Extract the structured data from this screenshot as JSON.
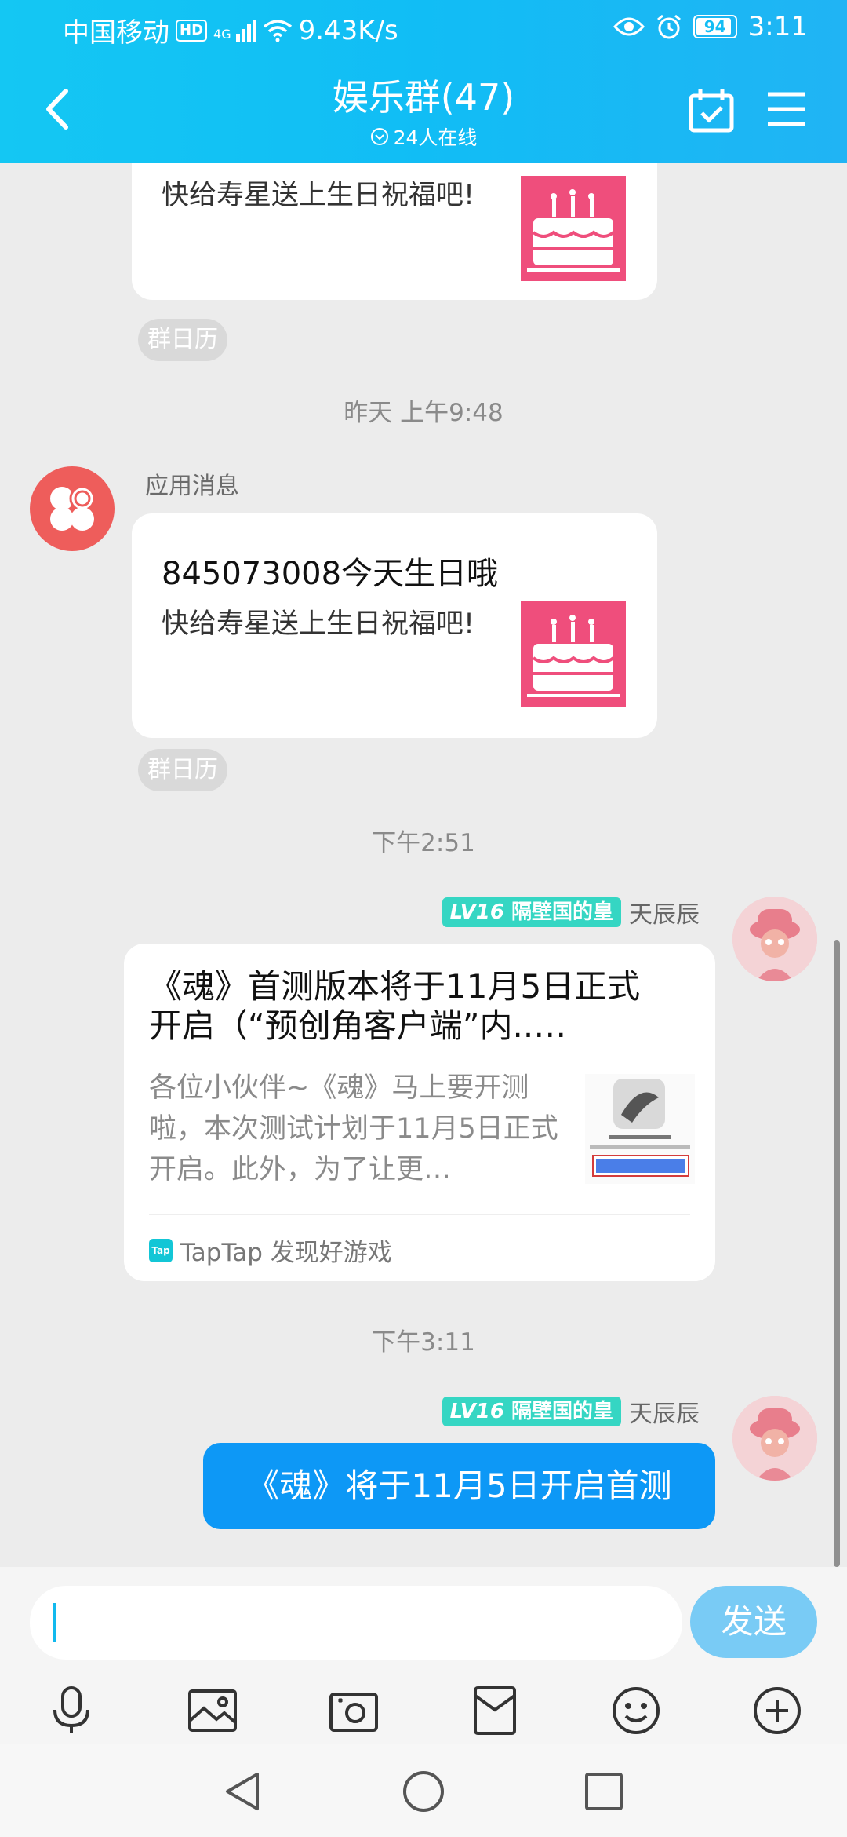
{
  "status_bar": {
    "carrier": "中国移动",
    "hd": "HD",
    "network": "4G",
    "speed": "9.43K/s",
    "battery": "94",
    "time": "3:11"
  },
  "header": {
    "title": "娱乐群(47)",
    "online": "24人在线"
  },
  "messages": {
    "card1": {
      "subtitle": "快给寿星送上生日祝福吧!",
      "tag": "群日历"
    },
    "time1": "昨天 上午9:48",
    "app_sender": "应用消息",
    "card2": {
      "title": "845073008今天生日哦",
      "subtitle": "快给寿星送上生日祝福吧!",
      "tag": "群日历"
    },
    "time2": "下午2:51",
    "share_sender": {
      "level": "LV16",
      "title": "隔壁国的皇",
      "name": "天辰辰"
    },
    "share": {
      "title": "《魂》首测版本将于11月5日正式开启（“预创角客户端”内..…",
      "desc": "各位小伙伴~《魂》马上要开测啦，本次测试计划于11月5日正式开启。此外，为了让更…",
      "source": "TapTap 发现好游戏",
      "source_logo": "Tap"
    },
    "time3": "下午3:11",
    "text_sender": {
      "level": "LV16",
      "title": "隔壁国的皇",
      "name": "天辰辰"
    },
    "text_message": "《魂》将于11月5日开启首测"
  },
  "input": {
    "value": "",
    "send_label": "发送"
  },
  "colors": {
    "header_bg": "#14c7f3",
    "bubble": "#0d98f6",
    "level_badge": "#35d6c3",
    "send_disabled": "#79cbf5"
  },
  "icons": [
    "back-icon",
    "calendar-check-icon",
    "menu-icon",
    "microphone-icon",
    "image-icon",
    "camera-icon",
    "red-packet-icon",
    "emoji-icon",
    "plus-icon",
    "nav-back-icon",
    "nav-home-icon",
    "nav-recents-icon"
  ]
}
